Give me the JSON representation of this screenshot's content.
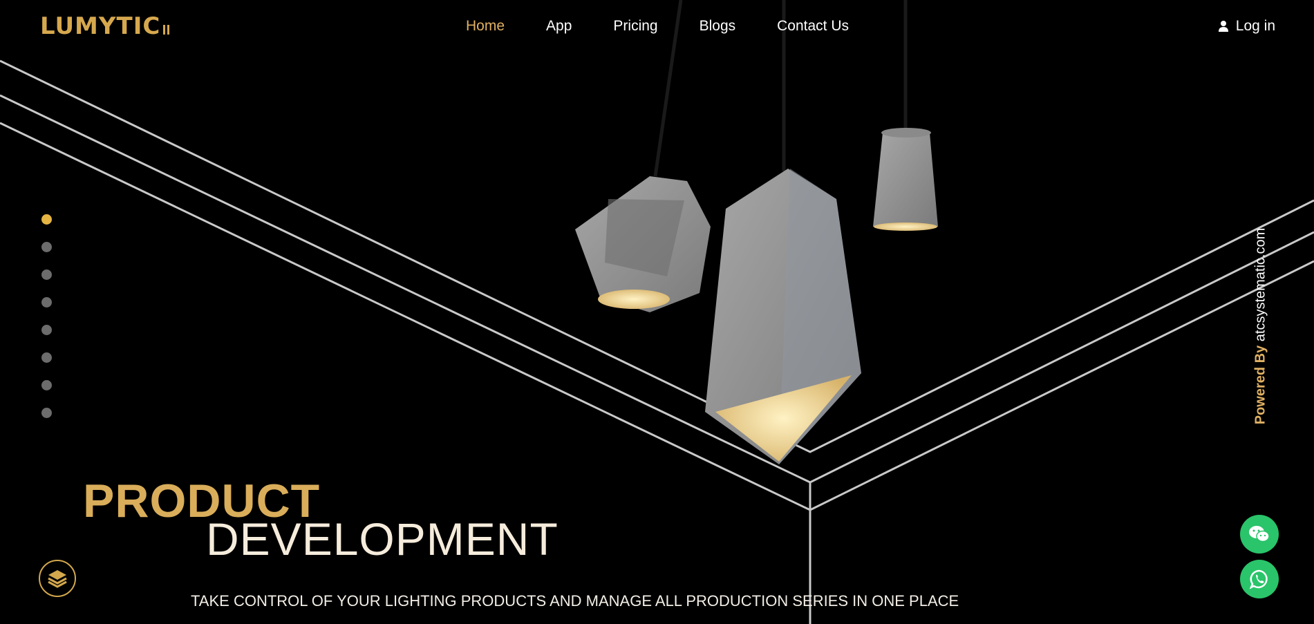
{
  "brand": {
    "logo_text": "LUMYTIC"
  },
  "nav": {
    "items": [
      "Home",
      "App",
      "Pricing",
      "Blogs",
      "Contact Us"
    ],
    "active": "Home"
  },
  "auth": {
    "login_label": "Log in"
  },
  "slider": {
    "total": 8,
    "active_index": 0
  },
  "powered": {
    "prefix": "Powered By",
    "site": "atcsystematic.com"
  },
  "hero": {
    "line1": "PRODUCT",
    "line2": "DEVELOPMENT",
    "tagline": "TAKE CONTROL OF YOUR LIGHTING PRODUCTS AND MANAGE ALL PRODUCTION SERIES IN ONE PLACE"
  },
  "colors": {
    "accent": "#e0b163",
    "background": "#000000",
    "chat_green": "#2ac46a",
    "dot_inactive": "#6c6c6c"
  },
  "icons": {
    "user": "user-icon",
    "layers": "layers-icon",
    "wechat": "wechat-icon",
    "whatsapp": "whatsapp-icon"
  }
}
